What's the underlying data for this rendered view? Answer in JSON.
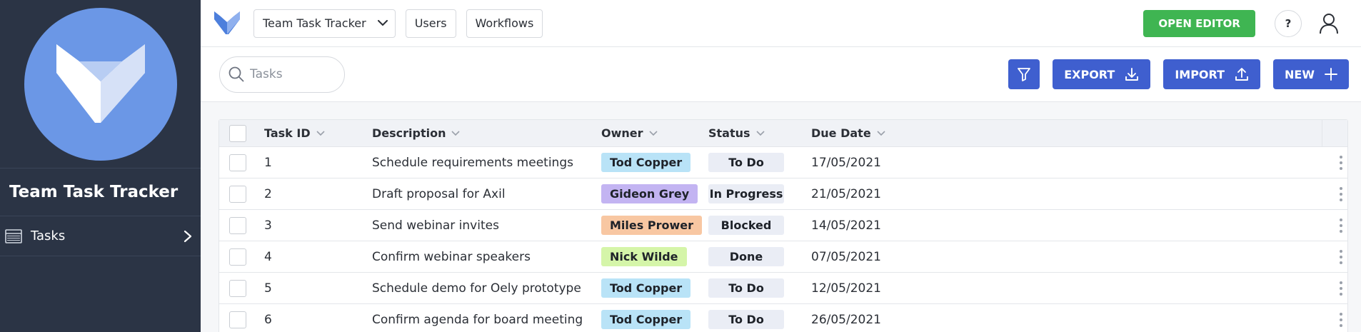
{
  "app": {
    "name": "Team Task Tracker"
  },
  "sidebar": {
    "items": [
      {
        "label": "Tasks"
      }
    ]
  },
  "topbar": {
    "app_selector": "Team Task Tracker",
    "users": "Users",
    "workflows": "Workflows",
    "open_editor": "OPEN EDITOR",
    "help": "?"
  },
  "actions": {
    "search_placeholder": "Tasks",
    "export": "EXPORT",
    "import": "IMPORT",
    "new": "NEW"
  },
  "table": {
    "columns": [
      "Task ID",
      "Description",
      "Owner",
      "Status",
      "Due Date"
    ],
    "rows": [
      {
        "id": "1",
        "description": "Schedule requirements meetings",
        "owner": "Tod Copper",
        "owner_color": "#b9e3f7",
        "status": "To Do",
        "due": "17/05/2021"
      },
      {
        "id": "2",
        "description": "Draft proposal for Axil",
        "owner": "Gideon Grey",
        "owner_color": "#c3b4f2",
        "status": "In Progress",
        "due": "21/05/2021"
      },
      {
        "id": "3",
        "description": "Send webinar invites",
        "owner": "Miles Prower",
        "owner_color": "#f8c7a2",
        "status": "Blocked",
        "due": "14/05/2021"
      },
      {
        "id": "4",
        "description": "Confirm webinar speakers",
        "owner": "Nick Wilde",
        "owner_color": "#d5f5a9",
        "status": "Done",
        "due": "07/05/2021"
      },
      {
        "id": "5",
        "description": "Schedule demo for Oely prototype",
        "owner": "Tod Copper",
        "owner_color": "#b9e3f7",
        "status": "To Do",
        "due": "12/05/2021"
      },
      {
        "id": "6",
        "description": "Confirm agenda for board meeting",
        "owner": "Tod Copper",
        "owner_color": "#b9e3f7",
        "status": "To Do",
        "due": "26/05/2021"
      }
    ]
  },
  "colors": {
    "sidebar_bg": "#2b3445",
    "logo_circle": "#6b97e6",
    "primary": "#3f5fcf",
    "open_editor": "#3fb552"
  },
  "icons": {
    "logo": "fox-logo-icon",
    "nav_tasks": "table-icon",
    "search": "search-icon",
    "filter": "filter-icon",
    "export": "download-icon",
    "import": "upload-icon",
    "new": "plus-icon",
    "user": "user-icon",
    "row_menu": "kebab-menu-icon"
  }
}
